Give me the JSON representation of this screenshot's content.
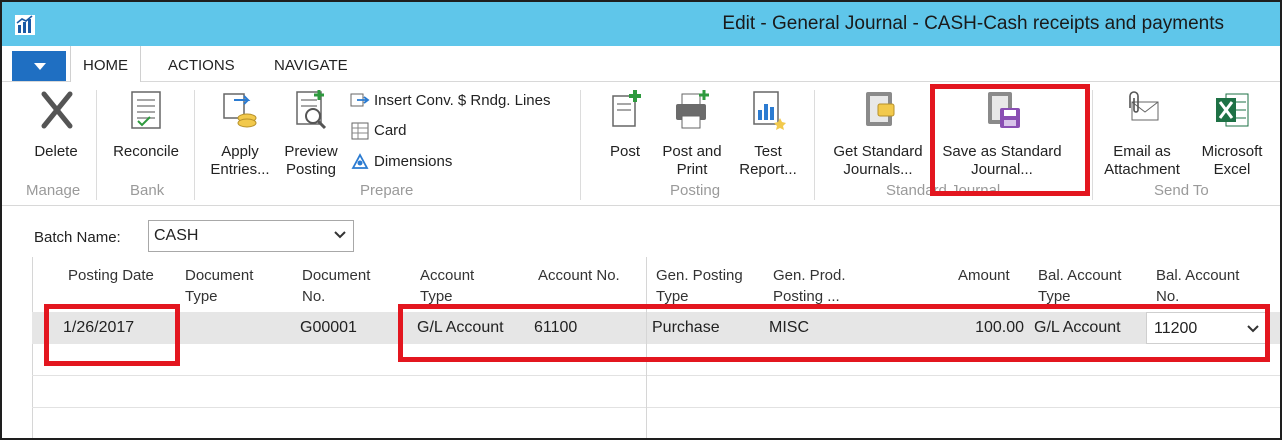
{
  "window": {
    "title": "Edit - General Journal - CASH-Cash receipts and payments"
  },
  "tabs": [
    "HOME",
    "ACTIONS",
    "NAVIGATE"
  ],
  "ribbon": {
    "groups": {
      "manage": "Manage",
      "bank": "Bank",
      "prepare": "Prepare",
      "posting": "Posting",
      "standard_journal": "Standard Journal",
      "send_to": "Send To"
    },
    "buttons": {
      "delete": "Delete",
      "reconcile": "Reconcile",
      "apply_entries_1": "Apply",
      "apply_entries_2": "Entries...",
      "preview_posting_1": "Preview",
      "preview_posting_2": "Posting",
      "insert_conv": "Insert Conv. $ Rndg. Lines",
      "card": "Card",
      "dimensions": "Dimensions",
      "post": "Post",
      "post_and_print_1": "Post and",
      "post_and_print_2": "Print",
      "test_report_1": "Test",
      "test_report_2": "Report...",
      "get_standard_1": "Get Standard",
      "get_standard_2": "Journals...",
      "save_standard_1": "Save as Standard",
      "save_standard_2": "Journal...",
      "email_attachment_1": "Email as",
      "email_attachment_2": "Attachment",
      "excel_1": "Microsoft",
      "excel_2": "Excel"
    }
  },
  "batch": {
    "label": "Batch Name:",
    "value": "CASH"
  },
  "grid": {
    "columns": [
      {
        "line1": "Posting Date",
        "line2": ""
      },
      {
        "line1": "Document",
        "line2": "Type"
      },
      {
        "line1": "Document",
        "line2": "No."
      },
      {
        "line1": "Account",
        "line2": "Type"
      },
      {
        "line1": "Account No.",
        "line2": ""
      },
      {
        "line1": "Gen. Posting",
        "line2": "Type"
      },
      {
        "line1": "Gen. Prod.",
        "line2": "Posting ..."
      },
      {
        "line1": "Amount",
        "line2": ""
      },
      {
        "line1": "Bal. Account",
        "line2": "Type"
      },
      {
        "line1": "Bal. Account",
        "line2": "No."
      }
    ],
    "rows": [
      {
        "posting_date": "1/26/2017",
        "document_type": "",
        "document_no": "G00001",
        "account_type": "G/L Account",
        "account_no": "61100",
        "gen_posting_type": "Purchase",
        "gen_prod_posting": "MISC",
        "amount": "100.00",
        "bal_account_type": "G/L Account",
        "bal_account_no": "11200"
      }
    ]
  },
  "colors": {
    "title_bar": "#5fc6ea",
    "app_menu": "#1f6fc2",
    "highlight": "#e3161f",
    "selected_row": "#e6e6e6"
  }
}
